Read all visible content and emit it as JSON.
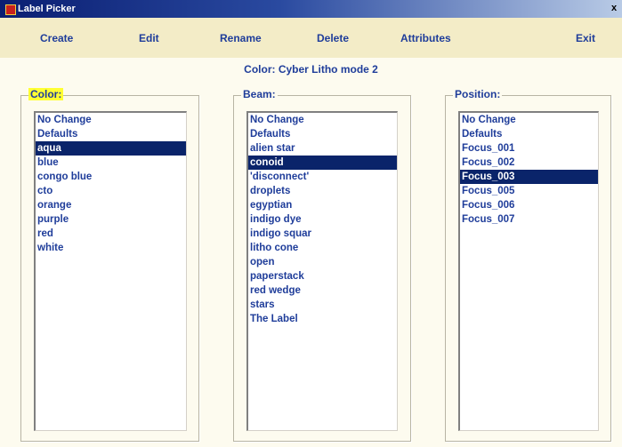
{
  "window": {
    "title": "Label Picker",
    "close_label": "x"
  },
  "menu": {
    "create": "Create",
    "edit": "Edit",
    "rename": "Rename",
    "delete": "Delete",
    "attributes": "Attributes",
    "exit": "Exit"
  },
  "subtitle": "Color: Cyber Litho mode 2",
  "colors": {
    "selection_bg": "#0a246a",
    "text": "#1f3d9a",
    "highlight": "#ffff33",
    "background": "#fdfbef"
  },
  "color_panel": {
    "label": "Color:",
    "items": [
      "No Change",
      "Defaults",
      "aqua",
      "blue",
      "congo blue",
      "cto",
      "orange",
      "purple",
      "red",
      "white"
    ],
    "selected": "aqua"
  },
  "beam_panel": {
    "label": "Beam:",
    "items": [
      "No Change",
      "Defaults",
      "alien star",
      "conoid",
      "'disconnect'",
      "droplets",
      "egyptian",
      "indigo dye",
      "indigo squar",
      "litho cone",
      "open",
      "paperstack",
      "red wedge",
      "stars",
      "The Label"
    ],
    "selected": "conoid"
  },
  "position_panel": {
    "label": "Position:",
    "items": [
      "No Change",
      "Defaults",
      "Focus_001",
      "Focus_002",
      "Focus_003",
      "Focus_005",
      "Focus_006",
      "Focus_007"
    ],
    "selected": "Focus_003"
  }
}
